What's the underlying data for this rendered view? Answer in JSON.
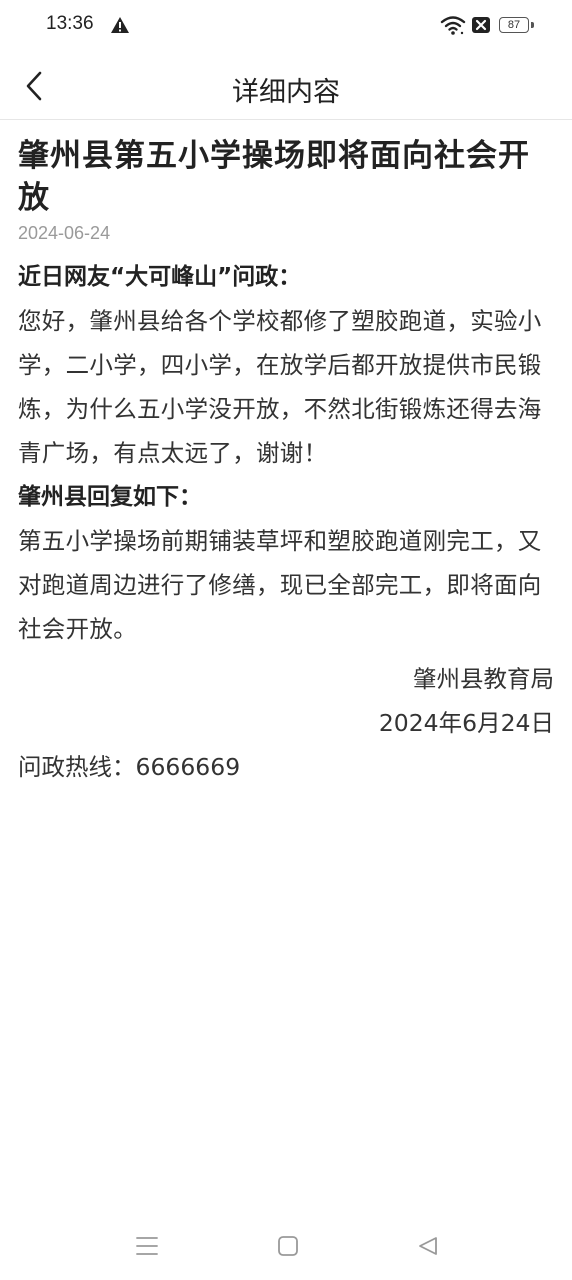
{
  "status_bar": {
    "time": "13:36",
    "battery": "87",
    "icons": [
      "warning-icon",
      "wifi-icon",
      "sim-off-icon",
      "battery-icon"
    ]
  },
  "header": {
    "title": "详细内容",
    "back_icon": "chevron-left-icon"
  },
  "article": {
    "title": "肇州县第五小学操场即将面向社会开放",
    "date": "2024-06-24",
    "question_heading": "近日网友“大可峰山”问政：",
    "question_body": "您好，肇州县给各个学校都修了塑胶跑道，实验小学，二小学，四小学，在放学后都开放提供市民锻炼，为什么五小学没开放，不然北街锻炼还得去海青广场，有点太远了，谢谢！",
    "reply_heading": "肇州县回复如下：",
    "reply_body": "第五小学操场前期铺装草坪和塑胶跑道刚完工，又对跑道周边进行了修缮，现已全部完工，即将面向社会开放。",
    "signature": "肇州县教育局",
    "signature_date": "2024年6月24日",
    "hotline": "问政热线：6666669"
  },
  "nav_bar": {
    "icons": [
      "menu-icon",
      "home-icon",
      "back-triangle-icon"
    ]
  }
}
